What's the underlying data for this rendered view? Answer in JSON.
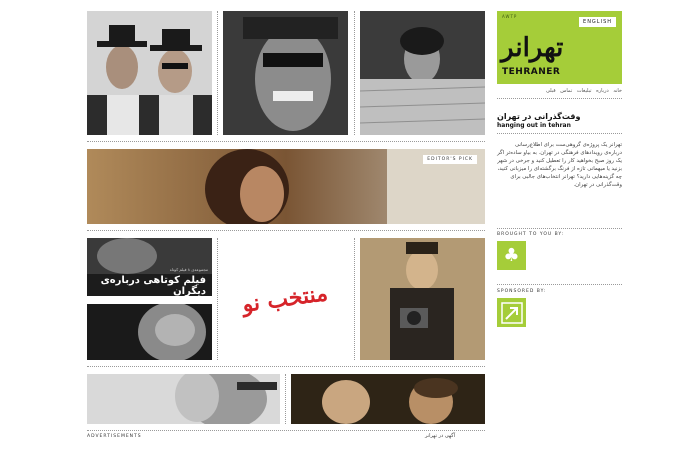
{
  "site": {
    "small_label": "AWTP",
    "english_link": "ENGLISH",
    "logo_fa": "تهرانر",
    "logo_en": "TEHRANER"
  },
  "nav": {
    "items": [
      "خانه",
      "درباره",
      "تبلیغات",
      "تماس",
      "قبلی"
    ]
  },
  "about": {
    "title_fa": "وقت‌گذرانی در تهران",
    "title_en": "hanging out in tehran",
    "text": "تهرانر یک پروژه‌ی گروهی‌ست برای اطلاع‌رسانی درباره‌ی رویدادهای فرهنگی در تهران. به بیاو ساده‌تر اگر یک روز صبح بخواهید کار را تعطیل کنید و جرخی در شهر بزنید یا میهمانی تازه از فرنگ برگشته‌ای را میزبانی کنید، چه گزینه‌هایی دارید؟ تهرانر انتخاب‌های جالبی برای وقت‌گذرانی در تهران."
  },
  "sponsors": {
    "brought_label": "BROUGHT TO YOU BY:",
    "sponsored_label": "SPONSORED BY:",
    "brought_icon": "club-icon",
    "sponsored_icon": "arrow-icon"
  },
  "tiles": {
    "editors_pick": "EDITOR'S PICK",
    "poster_title": "فیلم کوتاهی درباره‌ی دیگران",
    "poster_small": "مجموعه‌ی ۸ فیلم کوتاه",
    "center_logo": "منتخب نو"
  },
  "footer": {
    "advertisements": "ADVERTISEMENTS",
    "right_text": "آگهی در تهرانر"
  },
  "colors": {
    "accent": "#a5cd39",
    "logo_red": "#d6242a"
  }
}
